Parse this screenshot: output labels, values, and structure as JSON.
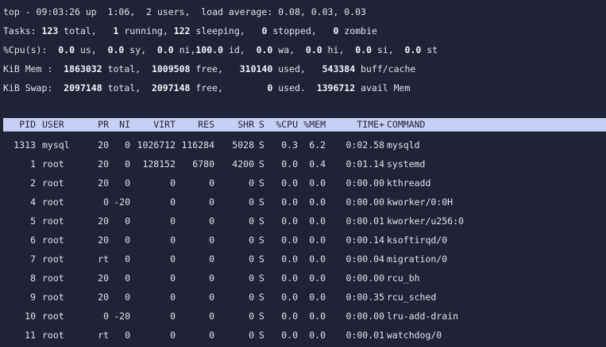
{
  "summary": {
    "uptime_line": "top - 09:03:26 up  1:06,  2 users,  load average: 0.08, 0.03, 0.03",
    "tasks": {
      "prefix": "Tasks: ",
      "total": "123",
      "total_label": " total,   ",
      "running": "1",
      "running_label": " running, ",
      "sleeping": "122",
      "sleeping_label": " sleeping,   ",
      "stopped": "0",
      "stopped_label": " stopped,   ",
      "zombie": "0",
      "zombie_label": " zombie"
    },
    "cpu": {
      "prefix": "%Cpu(s):  ",
      "us": "0.0",
      "us_label": " us,  ",
      "sy": "0.0",
      "sy_label": " sy,  ",
      "ni": "0.0",
      "ni_label": " ni,",
      "id": "100.0",
      "id_label": " id,  ",
      "wa": "0.0",
      "wa_label": " wa,  ",
      "hi": "0.0",
      "hi_label": " hi,  ",
      "si": "0.0",
      "si_label": " si,  ",
      "st": "0.0",
      "st_label": " st"
    },
    "mem": {
      "prefix": "KiB Mem :  ",
      "total": "1863032",
      "total_label": " total,  ",
      "free": "1009508",
      "free_label": " free,   ",
      "used": "310140",
      "used_label": " used,   ",
      "buff": "543384",
      "buff_label": " buff/cache"
    },
    "swap": {
      "prefix": "KiB Swap:  ",
      "total": "2097148",
      "total_label": " total,  ",
      "free": "2097148",
      "free_label": " free,        ",
      "used": "0",
      "used_label": " used.  ",
      "avail": "1396712",
      "avail_label": " avail Mem"
    }
  },
  "columns": {
    "pid": "PID",
    "user": "USER",
    "pr": "PR",
    "ni": "NI",
    "virt": "VIRT",
    "res": "RES",
    "shr": "SHR",
    "s": "S",
    "cpu": "%CPU",
    "mem": "%MEM",
    "time": "TIME+",
    "command": "COMMAND"
  },
  "processes": [
    {
      "pid": "1313",
      "user": "mysql",
      "pr": "20",
      "ni": "0",
      "virt": "1026712",
      "res": "116284",
      "shr": "5028",
      "s": "S",
      "cpu": "0.3",
      "mem": "6.2",
      "time": "0:02.58",
      "command": "mysqld"
    },
    {
      "pid": "1",
      "user": "root",
      "pr": "20",
      "ni": "0",
      "virt": "128152",
      "res": "6780",
      "shr": "4200",
      "s": "S",
      "cpu": "0.0",
      "mem": "0.4",
      "time": "0:01.14",
      "command": "systemd"
    },
    {
      "pid": "2",
      "user": "root",
      "pr": "20",
      "ni": "0",
      "virt": "0",
      "res": "0",
      "shr": "0",
      "s": "S",
      "cpu": "0.0",
      "mem": "0.0",
      "time": "0:00.00",
      "command": "kthreadd"
    },
    {
      "pid": "4",
      "user": "root",
      "pr": "0",
      "ni": "-20",
      "virt": "0",
      "res": "0",
      "shr": "0",
      "s": "S",
      "cpu": "0.0",
      "mem": "0.0",
      "time": "0:00.00",
      "command": "kworker/0:0H"
    },
    {
      "pid": "5",
      "user": "root",
      "pr": "20",
      "ni": "0",
      "virt": "0",
      "res": "0",
      "shr": "0",
      "s": "S",
      "cpu": "0.0",
      "mem": "0.0",
      "time": "0:00.01",
      "command": "kworker/u256:0"
    },
    {
      "pid": "6",
      "user": "root",
      "pr": "20",
      "ni": "0",
      "virt": "0",
      "res": "0",
      "shr": "0",
      "s": "S",
      "cpu": "0.0",
      "mem": "0.0",
      "time": "0:00.14",
      "command": "ksoftirqd/0"
    },
    {
      "pid": "7",
      "user": "root",
      "pr": "rt",
      "ni": "0",
      "virt": "0",
      "res": "0",
      "shr": "0",
      "s": "S",
      "cpu": "0.0",
      "mem": "0.0",
      "time": "0:00.04",
      "command": "migration/0"
    },
    {
      "pid": "8",
      "user": "root",
      "pr": "20",
      "ni": "0",
      "virt": "0",
      "res": "0",
      "shr": "0",
      "s": "S",
      "cpu": "0.0",
      "mem": "0.0",
      "time": "0:00.00",
      "command": "rcu_bh"
    },
    {
      "pid": "9",
      "user": "root",
      "pr": "20",
      "ni": "0",
      "virt": "0",
      "res": "0",
      "shr": "0",
      "s": "S",
      "cpu": "0.0",
      "mem": "0.0",
      "time": "0:00.35",
      "command": "rcu_sched"
    },
    {
      "pid": "10",
      "user": "root",
      "pr": "0",
      "ni": "-20",
      "virt": "0",
      "res": "0",
      "shr": "0",
      "s": "S",
      "cpu": "0.0",
      "mem": "0.0",
      "time": "0:00.00",
      "command": "lru-add-drain"
    },
    {
      "pid": "11",
      "user": "root",
      "pr": "rt",
      "ni": "0",
      "virt": "0",
      "res": "0",
      "shr": "0",
      "s": "S",
      "cpu": "0.0",
      "mem": "0.0",
      "time": "0:00.01",
      "command": "watchdog/0"
    }
  ]
}
